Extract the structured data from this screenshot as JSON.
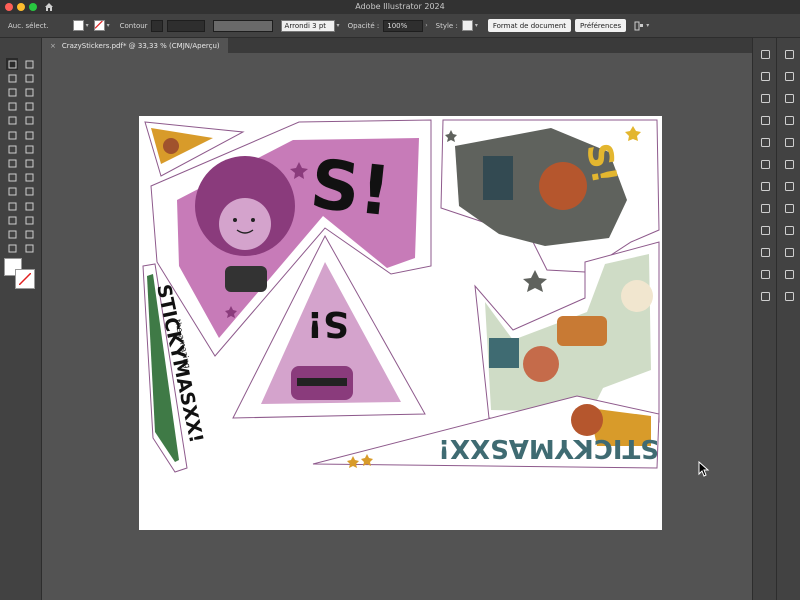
{
  "window": {
    "title": "Adobe Illustrator 2024"
  },
  "control_bar": {
    "selection_label": "Auc. sélect.",
    "stroke_label": "Contour",
    "brush_value": "Arrondi 3 pt",
    "opacity_label": "Opacité :",
    "opacity_value": "100%",
    "style_label": "Style :",
    "doc_setup_button": "Format de document",
    "prefs_button": "Préférences"
  },
  "tabs": [
    {
      "label": "CrazyStickers.pdf* @ 33,33 % (CMJN/Aperçu)"
    }
  ],
  "stickers": {
    "s_text": "S!",
    "green_badge": "STICKYMASXX!",
    "green_badge_sub": "the amazing",
    "blue_banner": "STICKYMASXX!"
  },
  "colors": {
    "titlebar": "#323232",
    "panel": "#424242",
    "canvas": "#535353",
    "artboard": "#ffffff",
    "pink": "#c77bb8",
    "pink_dark": "#8a3b7c",
    "slate": "#5f625d",
    "sage": "#cfdcc6",
    "teal": "#3f6b72",
    "mustard": "#d89b2a",
    "green_badge": "#3f7a46",
    "outline_purple": "#8e5a8c"
  },
  "icons": {
    "home": "home-icon",
    "close_tab": "close-icon"
  }
}
